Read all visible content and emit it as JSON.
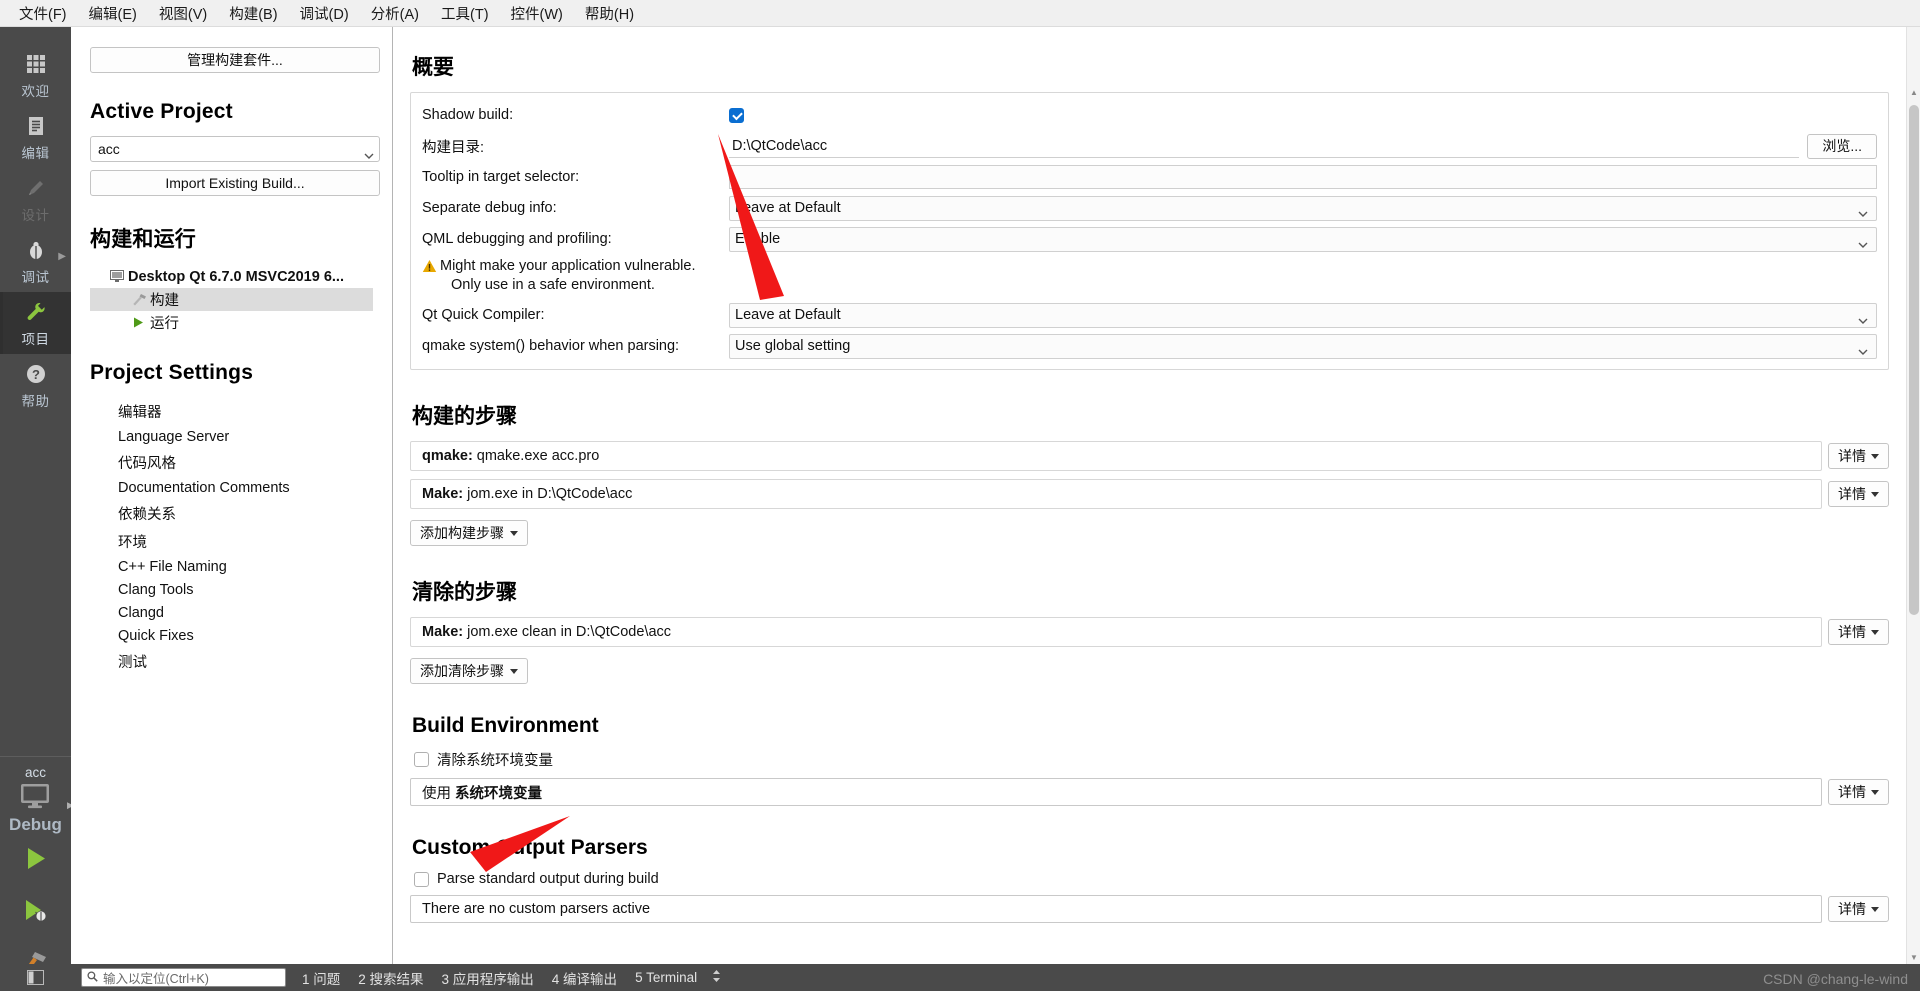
{
  "menubar": [
    {
      "label": "文件(F)",
      "name": "menu-file"
    },
    {
      "label": "编辑(E)",
      "name": "menu-edit"
    },
    {
      "label": "视图(V)",
      "name": "menu-view"
    },
    {
      "label": "构建(B)",
      "name": "menu-build"
    },
    {
      "label": "调试(D)",
      "name": "menu-debug"
    },
    {
      "label": "分析(A)",
      "name": "menu-analyze"
    },
    {
      "label": "工具(T)",
      "name": "menu-tools"
    },
    {
      "label": "控件(W)",
      "name": "menu-widgets"
    },
    {
      "label": "帮助(H)",
      "name": "menu-help"
    }
  ],
  "modebar": {
    "modes": [
      {
        "label": "欢迎",
        "icon": "grid-icon",
        "active": false,
        "disabled": false
      },
      {
        "label": "编辑",
        "icon": "document-icon",
        "active": false,
        "disabled": false
      },
      {
        "label": "设计",
        "icon": "pencil-icon",
        "active": false,
        "disabled": true
      },
      {
        "label": "调试",
        "icon": "bug-icon",
        "active": false,
        "disabled": false,
        "has_arrow": true
      },
      {
        "label": "项目",
        "icon": "wrench-icon",
        "active": true,
        "disabled": false
      },
      {
        "label": "帮助",
        "icon": "question-circle-icon",
        "active": false,
        "disabled": false
      }
    ],
    "target": {
      "project": "acc",
      "config": "Debug",
      "device_icon": "desktop-monitor-icon"
    },
    "actions": [
      {
        "name": "run-button",
        "icon": "play-icon"
      },
      {
        "name": "debug-button",
        "icon": "play-bug-icon"
      },
      {
        "name": "build-button",
        "icon": "hammer-icon"
      }
    ]
  },
  "leftpanel": {
    "manage_kits_button": "管理构建套件...",
    "active_project_title": "Active Project",
    "active_project_value": "acc",
    "import_build_button": "Import Existing Build...",
    "build_and_run_title": "构建和运行",
    "kit": {
      "label": "Desktop Qt 6.7.0 MSVC2019 6...",
      "children": [
        {
          "label": "构建",
          "icon": "build-hammer-icon",
          "selected": true
        },
        {
          "label": "运行",
          "icon": "run-play-icon",
          "selected": false
        }
      ]
    },
    "project_settings_title": "Project Settings",
    "project_settings_items": [
      "编辑器",
      "Language Server",
      "代码风格",
      "Documentation Comments",
      "依赖关系",
      "环境",
      "C++ File Naming",
      "Clang Tools",
      "Clangd",
      "Quick Fixes",
      "测试"
    ]
  },
  "main": {
    "summary": {
      "title": "概要",
      "shadow_build_label": "Shadow build:",
      "shadow_build_checked": true,
      "build_dir_label": "构建目录:",
      "build_dir_value": "D:\\QtCode\\acc",
      "browse_button": "浏览...",
      "tooltip_label": "Tooltip in target selector:",
      "tooltip_value": "",
      "separate_debug_label": "Separate debug info:",
      "separate_debug_value": "Leave at Default",
      "qml_debug_label": "QML debugging and profiling:",
      "qml_debug_value": "Enable",
      "warning_line1": "Might make your application vulnerable.",
      "warning_line2": "Only use in a safe environment.",
      "qt_quick_label": "Qt Quick Compiler:",
      "qt_quick_value": "Leave at Default",
      "qmake_system_label": "qmake system() behavior when parsing:",
      "qmake_system_value": "Use global setting"
    },
    "build_steps": {
      "title": "构建的步骤",
      "steps": [
        {
          "name": "qmake:",
          "value": "qmake.exe acc.pro",
          "detail": "详情"
        },
        {
          "name": "Make:",
          "value": "jom.exe in D:\\QtCode\\acc",
          "detail": "详情"
        }
      ],
      "add_button": "添加构建步骤"
    },
    "clean_steps": {
      "title": "清除的步骤",
      "steps": [
        {
          "name": "Make:",
          "value": "jom.exe clean in D:\\QtCode\\acc",
          "detail": "详情"
        }
      ],
      "add_button": "添加清除步骤"
    },
    "build_environment": {
      "title": "Build Environment",
      "clear_checkbox_label": "清除系统环境变量",
      "clear_checked": false,
      "use_prefix": "使用",
      "use_value": "系统环境变量",
      "detail": "详情"
    },
    "custom_parsers": {
      "title": "Custom Output Parsers",
      "parse_checkbox_label": "Parse standard output during build",
      "parse_checked": false,
      "empty_text": "There are no custom parsers active",
      "detail": "详情"
    }
  },
  "statusbar": {
    "search_placeholder": "输入以定位(Ctrl+K)",
    "outputs": [
      "1 问题",
      "2 搜索结果",
      "3 应用程序输出",
      "4 编译输出",
      "5 Terminal"
    ],
    "watermark": "CSDN @chang-le-wind"
  },
  "colors": {
    "accent_blue": "#0a6ed1",
    "sidebar_bg": "#4a4a4a",
    "annotation_red": "#f01818",
    "green": "#7fb131",
    "warn_yellow": "#e8a800"
  }
}
